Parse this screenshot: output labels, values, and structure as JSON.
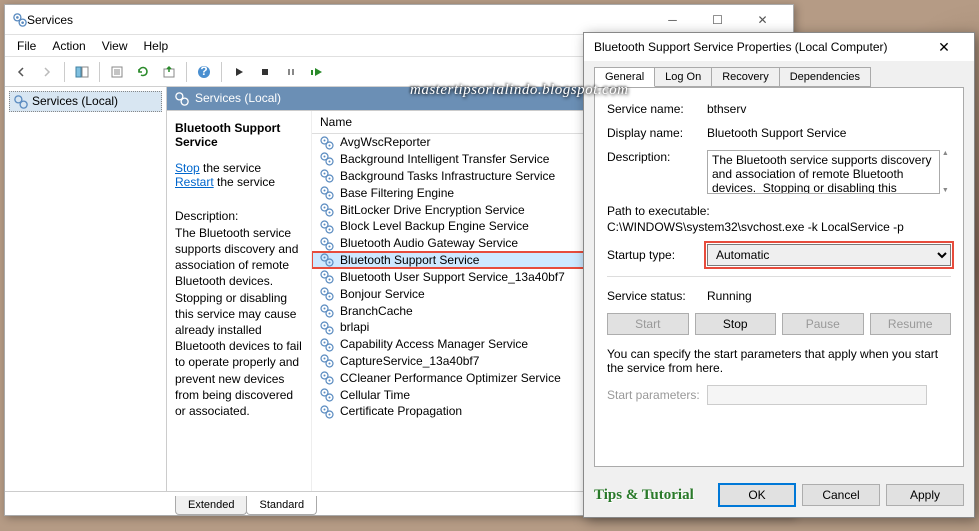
{
  "services_window": {
    "title": "Services",
    "menu": [
      "File",
      "Action",
      "View",
      "Help"
    ],
    "left_pane_item": "Services (Local)",
    "header": "Services (Local)",
    "detail": {
      "service_name": "Bluetooth Support Service",
      "stop_link": "Stop",
      "stop_suffix": " the service",
      "restart_link": "Restart",
      "restart_suffix": " the service",
      "desc_label": "Description:",
      "desc_text": "The Bluetooth service supports discovery and association of remote Bluetooth devices.  Stopping or disabling this service may cause already installed Bluetooth devices to fail to operate properly and prevent new devices from being discovered or associated."
    },
    "list_header": "Name",
    "services": [
      "AvgWscReporter",
      "Background Intelligent Transfer Service",
      "Background Tasks Infrastructure Service",
      "Base Filtering Engine",
      "BitLocker Drive Encryption Service",
      "Block Level Backup Engine Service",
      "Bluetooth Audio Gateway Service",
      "Bluetooth Support Service",
      "Bluetooth User Support Service_13a40bf7",
      "Bonjour Service",
      "BranchCache",
      "brlapi",
      "Capability Access Manager Service",
      "CaptureService_13a40bf7",
      "CCleaner Performance Optimizer Service",
      "Cellular Time",
      "Certificate Propagation"
    ],
    "selected_index": 7,
    "bottom_tabs": {
      "extended": "Extended",
      "standard": "Standard",
      "active": "standard"
    }
  },
  "props_dialog": {
    "title": "Bluetooth Support Service Properties (Local Computer)",
    "tabs": [
      "General",
      "Log On",
      "Recovery",
      "Dependencies"
    ],
    "active_tab": 0,
    "labels": {
      "service_name": "Service name:",
      "display_name": "Display name:",
      "description": "Description:",
      "path": "Path to executable:",
      "startup_type": "Startup type:",
      "service_status": "Service status:",
      "start_params": "Start parameters:",
      "hint": "You can specify the start parameters that apply when you start the service from here."
    },
    "values": {
      "service_name": "bthserv",
      "display_name": "Bluetooth Support Service",
      "description": "The Bluetooth service supports discovery and association of remote Bluetooth devices.  Stopping or disabling this service may cause already installed",
      "path": "C:\\WINDOWS\\system32\\svchost.exe -k LocalService -p",
      "startup_type": "Automatic",
      "service_status": "Running",
      "start_params": ""
    },
    "buttons": {
      "start": "Start",
      "stop": "Stop",
      "pause": "Pause",
      "resume": "Resume",
      "ok": "OK",
      "cancel": "Cancel",
      "apply": "Apply"
    }
  },
  "watermark": "mastertipsorialindo.blogspot.com",
  "brand": "Tips & Tutorial"
}
